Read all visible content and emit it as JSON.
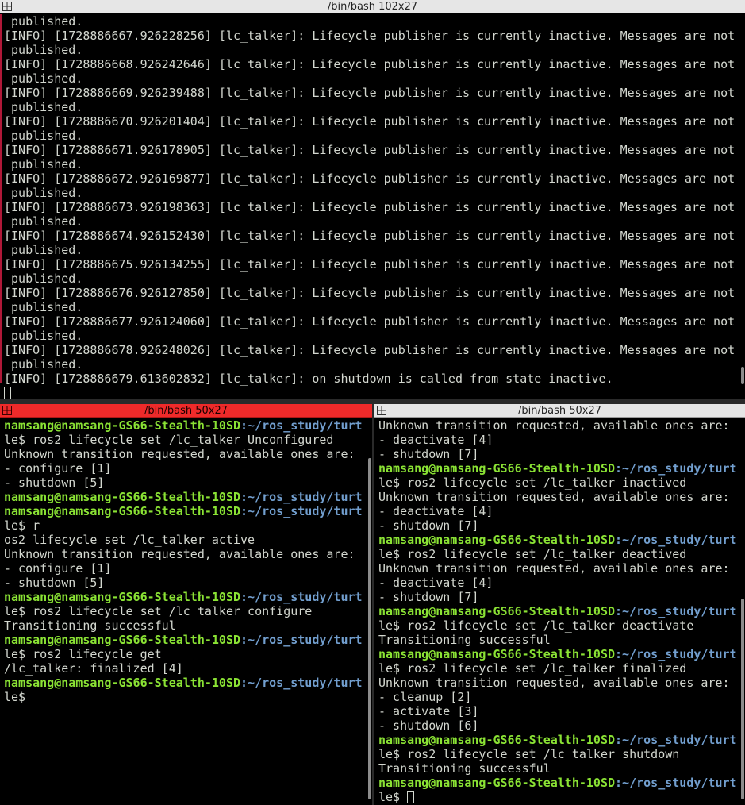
{
  "panes": {
    "top": {
      "title": "/bin/bash 102x27",
      "lines": [
        " published.",
        "[INFO] [1728886667.926228256] [lc_talker]: Lifecycle publisher is currently inactive. Messages are not",
        " published.",
        "[INFO] [1728886668.926242646] [lc_talker]: Lifecycle publisher is currently inactive. Messages are not",
        " published.",
        "[INFO] [1728886669.926239488] [lc_talker]: Lifecycle publisher is currently inactive. Messages are not",
        " published.",
        "[INFO] [1728886670.926201404] [lc_talker]: Lifecycle publisher is currently inactive. Messages are not",
        " published.",
        "[INFO] [1728886671.926178905] [lc_talker]: Lifecycle publisher is currently inactive. Messages are not",
        " published.",
        "[INFO] [1728886672.926169877] [lc_talker]: Lifecycle publisher is currently inactive. Messages are not",
        " published.",
        "[INFO] [1728886673.926198363] [lc_talker]: Lifecycle publisher is currently inactive. Messages are not",
        " published.",
        "[INFO] [1728886674.926152430] [lc_talker]: Lifecycle publisher is currently inactive. Messages are not",
        " published.",
        "[INFO] [1728886675.926134255] [lc_talker]: Lifecycle publisher is currently inactive. Messages are not",
        " published.",
        "[INFO] [1728886676.926127850] [lc_talker]: Lifecycle publisher is currently inactive. Messages are not",
        " published.",
        "[INFO] [1728886677.926124060] [lc_talker]: Lifecycle publisher is currently inactive. Messages are not",
        " published.",
        "[INFO] [1728886678.926248026] [lc_talker]: Lifecycle publisher is currently inactive. Messages are not",
        " published.",
        "[INFO] [1728886679.613602832] [lc_talker]: on shutdown is called from state inactive."
      ]
    },
    "left": {
      "title": "/bin/bash 50x27",
      "prompt_user": "namsang@namsang-GS66-Stealth-10SD",
      "prompt_path": ":~/ros_study/turt",
      "prompt_tail": "le$",
      "lines": [
        {
          "type": "prompt"
        },
        {
          "type": "text",
          "text": "le$ ros2 lifecycle set /lc_talker Unconfigured"
        },
        {
          "type": "text",
          "text": "Unknown transition requested, available ones are:"
        },
        {
          "type": "text",
          "text": "- configure [1]"
        },
        {
          "type": "text",
          "text": "- shutdown [5]"
        },
        {
          "type": "prompt"
        },
        {
          "type": "prompt"
        },
        {
          "type": "text",
          "text": "le$ r"
        },
        {
          "type": "text",
          "text": "os2 lifecycle set /lc_talker active"
        },
        {
          "type": "text",
          "text": "Unknown transition requested, available ones are:"
        },
        {
          "type": "text",
          "text": "- configure [1]"
        },
        {
          "type": "text",
          "text": "- shutdown [5]"
        },
        {
          "type": "prompt"
        },
        {
          "type": "text",
          "text": "le$ ros2 lifecycle set /lc_talker configure"
        },
        {
          "type": "text",
          "text": "Transitioning successful"
        },
        {
          "type": "prompt"
        },
        {
          "type": "text",
          "text": "le$ ros2 lifecycle get"
        },
        {
          "type": "text",
          "text": "/lc_talker: finalized [4]"
        },
        {
          "type": "prompt"
        },
        {
          "type": "text",
          "text": "le$"
        }
      ]
    },
    "right": {
      "title": "/bin/bash 50x27",
      "prompt_user": "namsang@namsang-GS66-Stealth-10SD",
      "prompt_path": ":~/ros_study/turt",
      "lines": [
        {
          "type": "text",
          "text": "Unknown transition requested, available ones are:"
        },
        {
          "type": "text",
          "text": "- deactivate [4]"
        },
        {
          "type": "text",
          "text": "- shutdown [7]"
        },
        {
          "type": "prompt"
        },
        {
          "type": "text",
          "text": "le$ ros2 lifecycle set /lc_talker inactived"
        },
        {
          "type": "text",
          "text": "Unknown transition requested, available ones are:"
        },
        {
          "type": "text",
          "text": "- deactivate [4]"
        },
        {
          "type": "text",
          "text": "- shutdown [7]"
        },
        {
          "type": "prompt"
        },
        {
          "type": "text",
          "text": "le$ ros2 lifecycle set /lc_talker deactived"
        },
        {
          "type": "text",
          "text": "Unknown transition requested, available ones are:"
        },
        {
          "type": "text",
          "text": "- deactivate [4]"
        },
        {
          "type": "text",
          "text": "- shutdown [7]"
        },
        {
          "type": "prompt"
        },
        {
          "type": "text",
          "text": "le$ ros2 lifecycle set /lc_talker deactivate"
        },
        {
          "type": "text",
          "text": "Transitioning successful"
        },
        {
          "type": "prompt"
        },
        {
          "type": "text",
          "text": "le$ ros2 lifecycle set /lc_talker finalized"
        },
        {
          "type": "text",
          "text": "Unknown transition requested, available ones are:"
        },
        {
          "type": "text",
          "text": "- cleanup [2]"
        },
        {
          "type": "text",
          "text": "- activate [3]"
        },
        {
          "type": "text",
          "text": "- shutdown [6]"
        },
        {
          "type": "prompt"
        },
        {
          "type": "text",
          "text": "le$ ros2 lifecycle set /lc_talker shutdown"
        },
        {
          "type": "text",
          "text": "Transitioning successful"
        },
        {
          "type": "prompt"
        },
        {
          "type": "text",
          "text": "le$ ",
          "cursor": true
        }
      ]
    }
  },
  "colors": {
    "background": "#000000",
    "text": "#d3d7cf",
    "prompt_user": "#8ae234",
    "prompt_path": "#729fcf",
    "active_titlebar": "#ef2a2a",
    "inactive_titlebar": "#e6e6e6"
  },
  "icons": {
    "pane_menu": "split-window-icon"
  }
}
